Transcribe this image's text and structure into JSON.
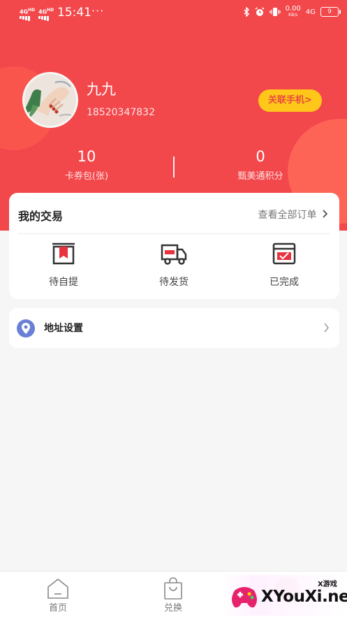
{
  "status_bar": {
    "signal_1": "4G",
    "signal_1_sup": "HD",
    "signal_2": "4G",
    "signal_2_sup": "HD",
    "time": "15:41",
    "dots": "···",
    "speed_value": "0.00",
    "speed_unit": "KB/s",
    "network": "4G",
    "battery": "9"
  },
  "profile": {
    "username": "九九",
    "phone": "18520347832",
    "link_phone_button": "关联手机>"
  },
  "stats": [
    {
      "value": "10",
      "label": "卡券包(张)"
    },
    {
      "value": "0",
      "label": "甄美通积分"
    }
  ],
  "orders_card": {
    "title": "我的交易",
    "view_all": "查看全部订单",
    "items": [
      {
        "label": "待自提",
        "icon": "pickup-store-icon"
      },
      {
        "label": "待发货",
        "icon": "delivery-truck-icon"
      },
      {
        "label": "已完成",
        "icon": "completed-calendar-icon"
      }
    ]
  },
  "address_card": {
    "label": "地址设置",
    "icon": "location-pin-icon"
  },
  "tab_bar": {
    "items": [
      {
        "label": "首页",
        "icon": "home-icon"
      },
      {
        "label": "兑换",
        "icon": "shopping-bag-icon"
      },
      {
        "label": "",
        "icon": "mine-icon"
      }
    ]
  },
  "watermark": {
    "text": "XYouXi.net",
    "sub": "X游戏"
  },
  "colors": {
    "brand_red": "#f2474b",
    "button_yellow": "#ffc71a",
    "icon_red": "#e8333f",
    "pin_blue": "#6a7fd6"
  }
}
